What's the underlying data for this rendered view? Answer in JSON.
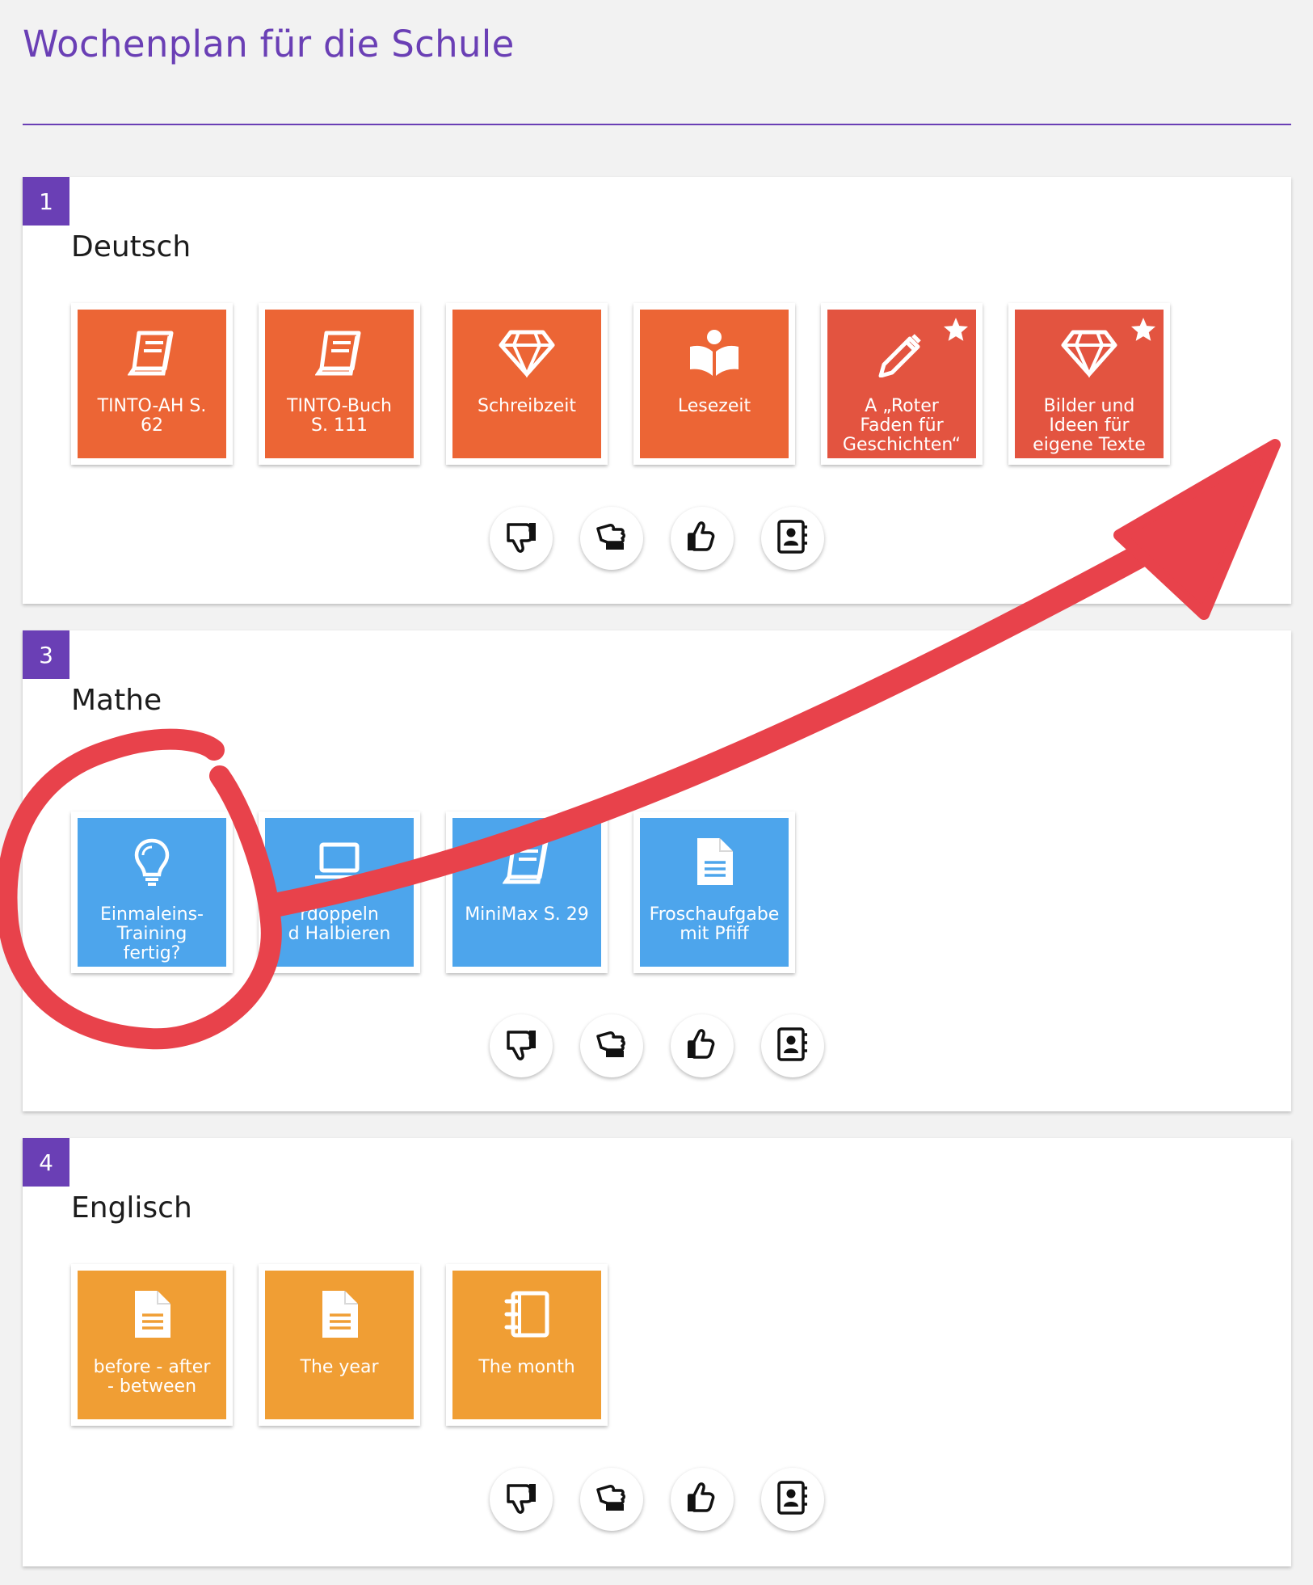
{
  "page": {
    "title": "Wochenplan für die Schule"
  },
  "colors": {
    "accent": "#6a3fb5",
    "deutsch_tile": "#ec6535",
    "deutsch_star_tile": "#e35440",
    "mathe_tile": "#4da5ec",
    "englisch_tile": "#f09e34",
    "annotation": "#e8424b"
  },
  "sections": [
    {
      "number": "1",
      "subject": "Deutsch",
      "tiles": [
        {
          "label": "TINTO-AH S.\n62",
          "icon": "book-icon",
          "starred": false
        },
        {
          "label": "TINTO-Buch\nS. 111",
          "icon": "book-icon",
          "starred": false
        },
        {
          "label": "Schreibzeit",
          "icon": "diamond-icon",
          "starred": false
        },
        {
          "label": "Lesezeit",
          "icon": "reader-icon",
          "starred": false
        },
        {
          "label": "A „Roter\nFaden für\nGeschichten“",
          "icon": "pencil-icon",
          "starred": true
        },
        {
          "label": "Bilder und\nIdeen für\neigene Texte",
          "icon": "diamond-icon",
          "starred": true
        }
      ]
    },
    {
      "number": "3",
      "subject": "Mathe",
      "tiles": [
        {
          "label": "Einmaleins-\nTraining\nfertig?",
          "icon": "lightbulb-icon",
          "starred": false
        },
        {
          "label": "rdoppeln\nd Halbieren",
          "icon": "laptop-icon",
          "starred": false
        },
        {
          "label": "MiniMax S. 29",
          "icon": "book-icon",
          "starred": false
        },
        {
          "label": "Froschaufgabe\nmit Pfiff",
          "icon": "document-icon",
          "starred": false
        }
      ]
    },
    {
      "number": "4",
      "subject": "Englisch",
      "tiles": [
        {
          "label": "before - after\n- between",
          "icon": "document-icon",
          "starred": false
        },
        {
          "label": "The year",
          "icon": "document-icon",
          "starred": false
        },
        {
          "label": "The month",
          "icon": "notebook-icon",
          "starred": false
        }
      ]
    }
  ],
  "feedback_buttons": [
    "thumbs-down-icon",
    "thumbs-sideways-icon",
    "thumbs-up-icon",
    "contact-book-icon"
  ]
}
